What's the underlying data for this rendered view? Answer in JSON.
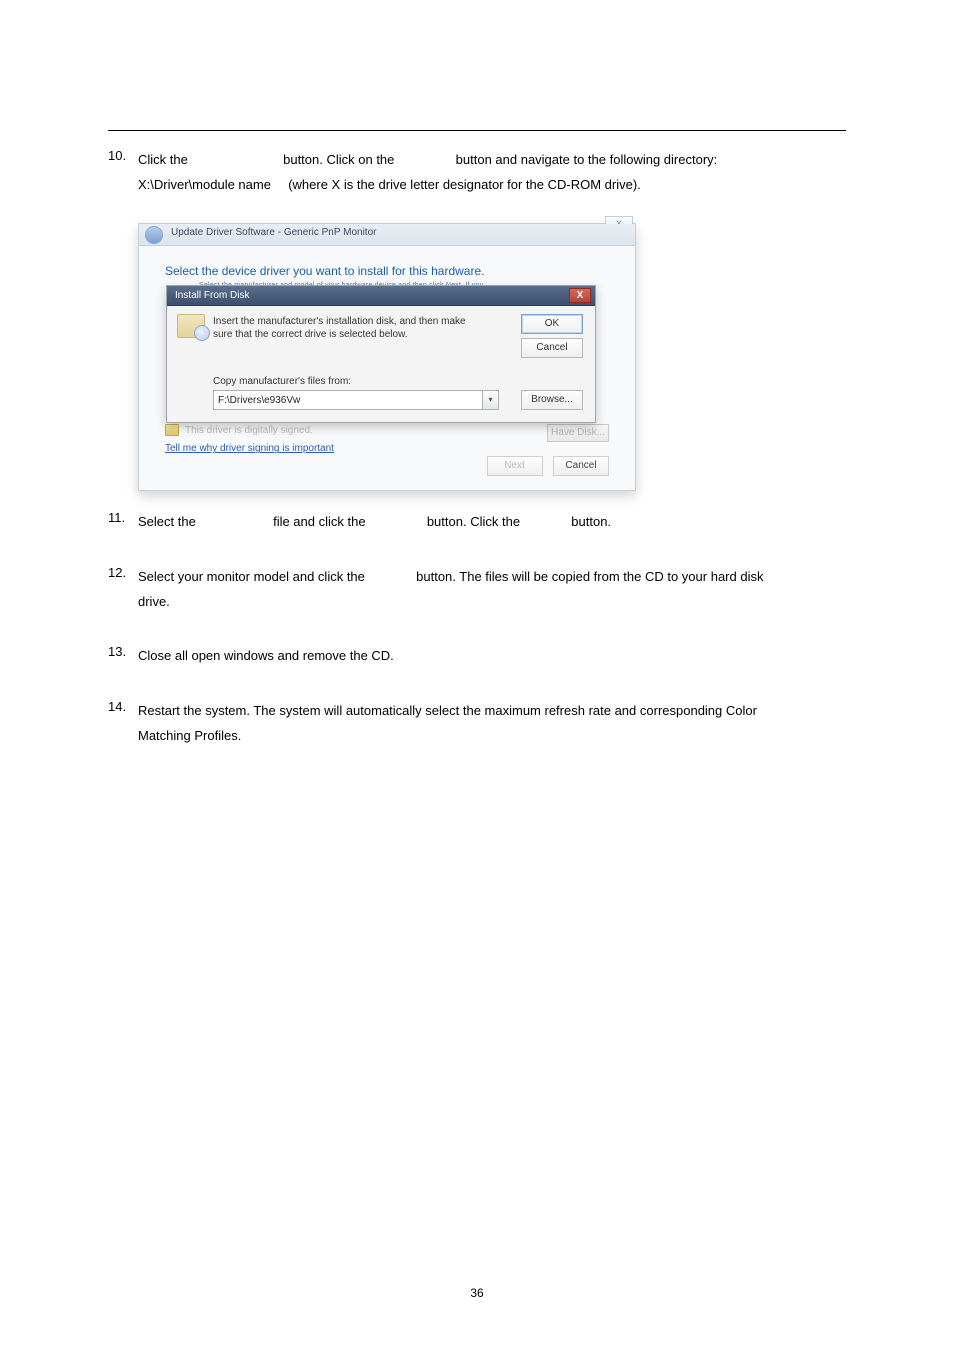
{
  "step10": {
    "num": "10.",
    "text_a": "Click the",
    "text_b": "button. Click on the",
    "text_c": "button and navigate to the following directory:",
    "line2_a": "X:\\Driver\\module name",
    "line2_b": "(where X is the drive letter designator for the CD-ROM drive)."
  },
  "screenshot": {
    "window": {
      "title": "Update Driver Software - Generic PnP Monitor",
      "close_icon": "X",
      "outer_close": "X",
      "heading": "Select the device driver you want to install for this hardware.",
      "subhead": "Select the manufacturer and model of your hardware device and then click Next. If you",
      "driver_signed": "This driver is digitally signed.",
      "have_disk": "Have Disk...",
      "sign_link": "Tell me why driver signing is important",
      "next_btn": "Next",
      "cancel_btn": "Cancel"
    },
    "modal": {
      "title": "Install From Disk",
      "close": "X",
      "instruction": "Insert the manufacturer's installation disk, and then make sure that the correct drive is selected below.",
      "ok": "OK",
      "cancel": "Cancel",
      "copy_label": "Copy manufacturer's files from:",
      "path_value": "F:\\Drivers\\e936Vw",
      "dropdown_icon": "▾",
      "browse": "Browse..."
    }
  },
  "step11": {
    "num": "11.",
    "a": "Select the",
    "b": "file and click the",
    "c": "button. Click the",
    "d": "button."
  },
  "step12": {
    "num": "12.",
    "a": "Select your monitor model and click the",
    "b": "button. The files will be copied from the CD to your hard disk",
    "c": "drive."
  },
  "step13": {
    "num": "13.",
    "a": "Close all open windows and remove the CD."
  },
  "step14": {
    "num": "14.",
    "a": "Restart the system. The system will automatically select the maximum refresh rate and corresponding Color",
    "b": "Matching Profiles."
  },
  "page_number": "36"
}
